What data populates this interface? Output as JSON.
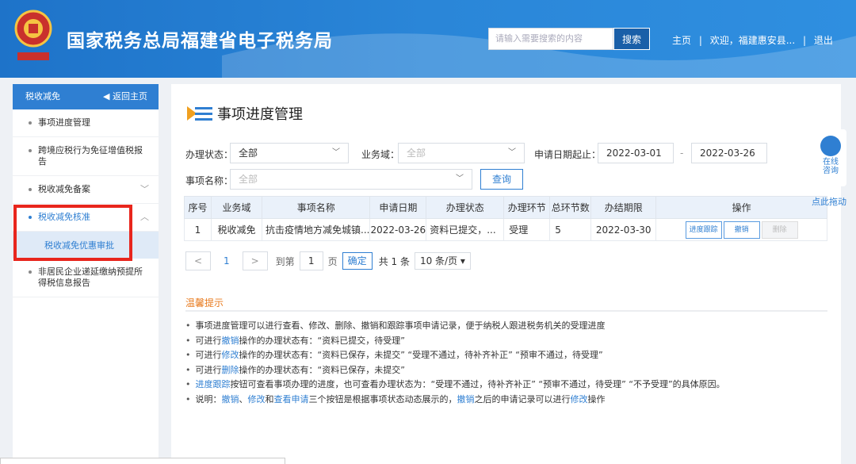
{
  "header": {
    "title": "国家税务总局福建省电子税务局",
    "search_placeholder": "请输入需要搜索的内容",
    "search_button": "搜索",
    "links": {
      "home": "主页",
      "sep1": "|",
      "welcome": "欢迎，福建惠安县...",
      "sep2": "|",
      "logout": "退出"
    }
  },
  "sidebar": {
    "title": "税收减免",
    "home_link": "返回主页",
    "items": [
      {
        "label": "事项进度管理"
      },
      {
        "label": "跨境应税行为免征增值税报告"
      },
      {
        "label": "税收减免备案"
      },
      {
        "label": "税收减免核准"
      },
      {
        "label": "非居民企业递延缴纳预提所得税信息报告"
      }
    ],
    "sub_item": "税收减免优惠审批"
  },
  "main": {
    "title": "事项进度管理",
    "filters": {
      "status_label": "办理状态：",
      "status_value": "全部",
      "domain_label": "业务域：",
      "domain_value": "全部",
      "date_label": "申请日期起止：",
      "date_from": "2022-03-01",
      "date_sep": "-",
      "date_to": "2022-03-26",
      "name_label": "事项名称：",
      "name_value": "全部",
      "query_button": "查询"
    },
    "table": {
      "headers": [
        "序号",
        "业务域",
        "事项名称",
        "申请日期",
        "办理状态",
        "办理环节",
        "总环节数",
        "办结期限",
        "操作"
      ],
      "rows": [
        {
          "cells": [
            "1",
            "税收减免",
            "抗击疫情地方减免城镇...",
            "2022-03-26",
            "资料已提交，...",
            "受理",
            "5",
            "2022-03-30"
          ],
          "actions": [
            "进度跟踪",
            "撤销",
            "删除"
          ]
        }
      ]
    },
    "pager": {
      "prev": "<",
      "page": "1",
      "next": ">",
      "goto": "到第",
      "input": "1",
      "unit": "页",
      "confirm": "确定",
      "total": "共 1 条",
      "size": "10 条/页 ▾"
    },
    "tips": {
      "title": "温馨提示",
      "lines": [
        {
          "a": "事项进度管理可以进行查看、修改、删除、撤销和跟踪事项申请记录，便于纳税人跟进税务机关的受理进度"
        },
        {
          "a": "可进行",
          "h": "撤销",
          "b": "操作的办理状态有：“资料已提交，待受理”"
        },
        {
          "a": "可进行",
          "h": "修改",
          "b": "操作的办理状态有：“资料已保存，未提交”  “受理不通过，待补齐补正”  “预审不通过，待受理”"
        },
        {
          "a": "可进行",
          "h": "删除",
          "b": "操作的办理状态有：“资料已保存，未提交”"
        },
        {
          "h": "进度跟踪",
          "b": "按钮可查看事项办理的进度，也可查看办理状态为：“受理不通过，待补齐补正”  “预审不通过，待受理”  “不予受理”的具体原因。"
        },
        {
          "a": "说明：",
          "h": "撤销",
          "b": "、",
          "h2": "修改",
          "c": "和",
          "h3": "查看申请",
          "d": "三个按钮是根据事项状态动态展示的，",
          "h4": "撤销",
          "e": "之后的申请记录可以进行",
          "h5": "修改",
          "f": "操作"
        }
      ]
    }
  },
  "float": {
    "line1": "在线",
    "line2": "咨询",
    "drag": "点此拖动"
  },
  "colors": {
    "header_blue": "#2a86d8",
    "accent": "#2f7fd2",
    "tip_orange": "#e87a1d",
    "highlight_red": "#e8261d"
  }
}
